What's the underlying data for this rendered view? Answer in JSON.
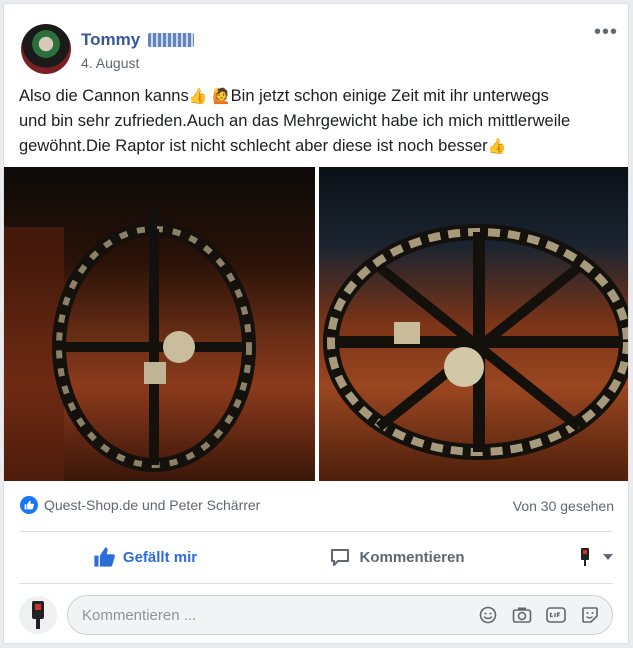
{
  "post": {
    "author": "Tommy",
    "date": "4. August",
    "more_label": "•••",
    "text_line1": "Also die Cannon kanns",
    "text_line1b": "Bin jetzt schon einige Zeit mit ihr unterwegs",
    "text_line2": "und bin sehr zufrieden.Auch an das Mehrgewicht habe ich mich mittlerweile",
    "text_line3": "gewöhnt.Die Raptor ist nicht schlecht aber diese ist noch besser",
    "emoji_thumb": "👍",
    "emoji_woman": "🙋",
    "photos": [
      {
        "icon": "photo-metal-detector-coil-1"
      },
      {
        "icon": "photo-metal-detector-coil-2"
      }
    ]
  },
  "reactions": {
    "likers": "Quest-Shop.de und Peter Schärrer",
    "seen": "Von 30 gesehen"
  },
  "actions": {
    "like_label": "Gefällt mir",
    "comment_label": "Kommentieren"
  },
  "comment_box": {
    "placeholder": "Kommentieren ..."
  },
  "colors": {
    "brand_link": "#385898",
    "like_blue": "#2d6dd9",
    "badge_blue": "#1877f2"
  }
}
